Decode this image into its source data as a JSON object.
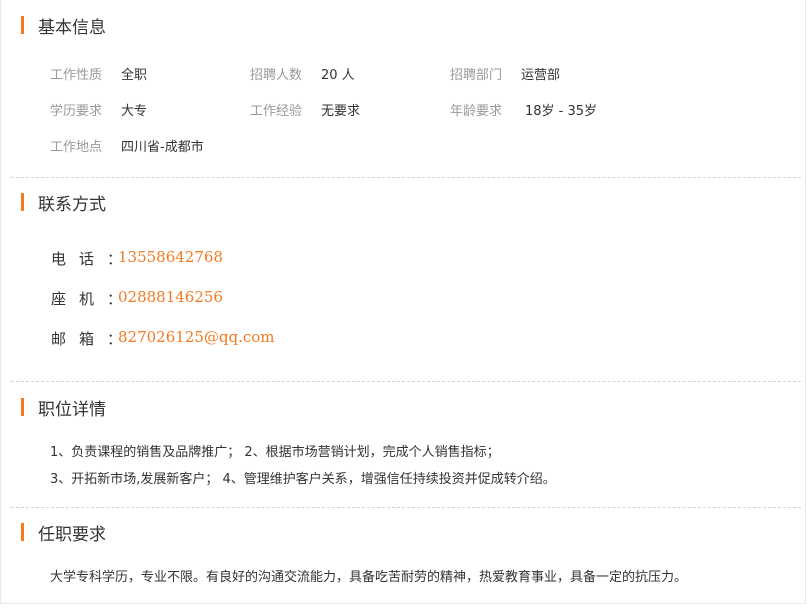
{
  "basic_info": {
    "title": "基本信息",
    "rows": [
      [
        {
          "label": "工作性质",
          "value": "全职"
        },
        {
          "label": "招聘人数",
          "value": "20 人"
        },
        {
          "label": "招聘部门",
          "value": "运营部"
        }
      ],
      [
        {
          "label": "学历要求",
          "value": "大专"
        },
        {
          "label": "工作经验",
          "value": "无要求"
        },
        {
          "label": "年龄要求",
          "value": "18岁 - 35岁"
        }
      ],
      [
        {
          "label": "工作地点",
          "value": "四川省-成都市"
        }
      ]
    ]
  },
  "contact": {
    "title": "联系方式",
    "phone_label": "电话：",
    "phone_value": "13558642768",
    "landline_label": "座机：",
    "landline_value": "02888146256",
    "email_label": "邮箱：",
    "email_value": "827026125@qq.com"
  },
  "job_details": {
    "title": "职位详情",
    "lines": [
      "1、负责课程的销售及品牌推广； 2、根据市场营销计划，完成个人销售指标；",
      "3、开拓新市场,发展新客户； 4、管理维护客户关系，增强信任持续投资并促成转介绍。"
    ]
  },
  "requirements": {
    "title": "任职要求",
    "text": "大学专科学历，专业不限。有良好的沟通交流能力，具备吃苦耐劳的精神，热爱教育事业，具备一定的抗压力。"
  },
  "colors": {
    "accent": "#f47920",
    "label": "#999999",
    "text": "#333333",
    "divider": "#d4d4d4"
  }
}
